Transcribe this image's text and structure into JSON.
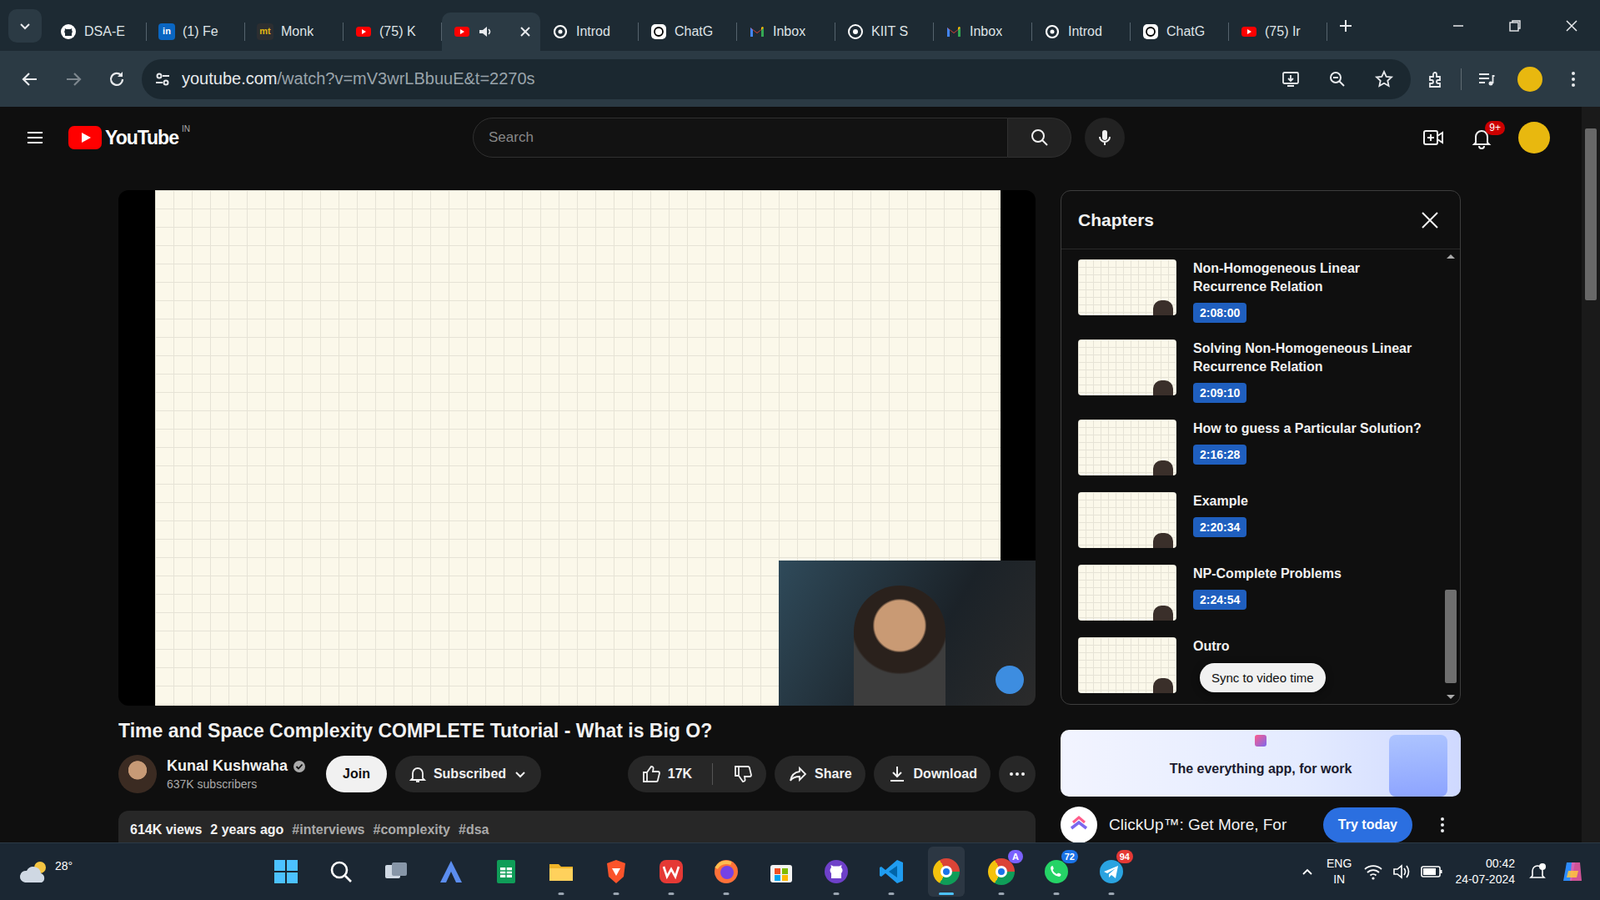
{
  "browser": {
    "tabs": [
      {
        "label": "DSA-E",
        "kind": "github",
        "selected": false,
        "audio": false
      },
      {
        "label": "(1) Fe",
        "kind": "linkedin",
        "glyph": "in",
        "selected": false,
        "audio": false
      },
      {
        "label": "Monk",
        "kind": "monkeytype",
        "glyph": "mt",
        "selected": false,
        "audio": false
      },
      {
        "label": "(75) K",
        "kind": "youtube",
        "selected": false,
        "audio": false
      },
      {
        "kind": "youtube",
        "selected": true,
        "audio": true
      },
      {
        "label": "Introd",
        "kind": "openai",
        "selected": false,
        "audio": false
      },
      {
        "label": "ChatG",
        "kind": "chatgpt",
        "selected": false,
        "audio": false
      },
      {
        "label": "Inbox",
        "kind": "gmail",
        "selected": false,
        "audio": false
      },
      {
        "label": "KIIT S",
        "kind": "kiit",
        "selected": false,
        "audio": false
      },
      {
        "label": "Inbox",
        "kind": "gmail",
        "selected": false,
        "audio": false
      },
      {
        "label": "Introd",
        "kind": "openai",
        "selected": false,
        "audio": false
      },
      {
        "label": "ChatG",
        "kind": "chatgpt",
        "selected": false,
        "audio": false
      },
      {
        "label": "(75) Ir",
        "kind": "youtube",
        "selected": false,
        "audio": false
      }
    ],
    "address": {
      "host": "youtube.com",
      "path": "/watch?v=mV3wrLBbuuE&t=2270s"
    }
  },
  "youtube": {
    "logo": "YouTube",
    "region": "IN",
    "search": {
      "placeholder": "Search"
    },
    "notifications": "9+"
  },
  "video": {
    "title": "Time and Space Complexity COMPLETE Tutorial - What is Big O?",
    "channel": {
      "name": "Kunal Kushwaha",
      "subscribers": "637K subscribers",
      "verified": true
    },
    "join": "Join",
    "subscribe": {
      "label": "Subscribed",
      "selected": true
    },
    "likes": "17K",
    "share": "Share",
    "download": "Download",
    "description": {
      "views": "614K views",
      "age": "2 years ago",
      "tags": [
        "#interviews",
        "#complexity",
        "#dsa"
      ]
    }
  },
  "chapters": {
    "title": "Chapters",
    "items": [
      {
        "title": "Non-Homogeneous Linear Recurrence Relation",
        "time": "2:08:00"
      },
      {
        "title": "Solving Non-Homogeneous Linear Recurrence Relation",
        "time": "2:09:10"
      },
      {
        "title": "How to guess a Particular Solution?",
        "time": "2:16:28"
      },
      {
        "title": "Example",
        "time": "2:20:34"
      },
      {
        "title": "NP-Complete Problems",
        "time": "2:24:54"
      },
      {
        "title": "Outro"
      }
    ],
    "tooltip": "Sync to video time"
  },
  "ad": {
    "banner": "The everything app, for work",
    "title": "ClickUp™: Get More, For",
    "cta": "Try today"
  },
  "taskbar": {
    "weather": "28°",
    "apps": [
      {
        "kind": "windows",
        "running": false,
        "selected": false
      },
      {
        "kind": "search",
        "running": false,
        "selected": false
      },
      {
        "kind": "taskview",
        "running": false,
        "selected": false
      },
      {
        "kind": "arc",
        "running": false,
        "selected": false
      },
      {
        "kind": "sheets",
        "running": false,
        "selected": false
      },
      {
        "kind": "folder",
        "running": true,
        "selected": false
      },
      {
        "kind": "brave",
        "running": true,
        "selected": false
      },
      {
        "kind": "wps",
        "running": true,
        "selected": false
      },
      {
        "kind": "firefox",
        "running": true,
        "selected": false
      },
      {
        "kind": "store",
        "running": false,
        "selected": false
      },
      {
        "kind": "github",
        "running": true,
        "selected": false
      },
      {
        "kind": "vscode",
        "running": true,
        "selected": false
      },
      {
        "kind": "chrome",
        "running": true,
        "selected": true
      },
      {
        "kind": "chrome",
        "running": true,
        "selected": false,
        "badge": "A",
        "badge_color": "#7b61ff"
      },
      {
        "kind": "whatsapp",
        "running": true,
        "selected": false,
        "badge": "72",
        "badge_color": "#1a73e8"
      },
      {
        "kind": "telegram",
        "running": true,
        "selected": false,
        "badge": "94",
        "badge_color": "#e53935"
      }
    ],
    "lang": [
      "ENG",
      "IN"
    ],
    "time": "00:42",
    "date": "24-07-2024"
  }
}
